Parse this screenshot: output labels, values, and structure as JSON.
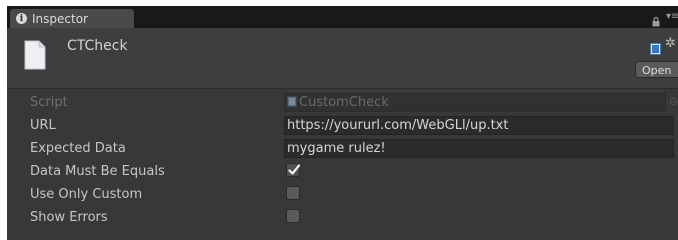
{
  "window": {
    "tab_label": "Inspector",
    "menu_glyph": "▾≡"
  },
  "component": {
    "name": "CTCheck",
    "open_label": "Open",
    "icons": [
      "document-icon",
      "script-icon",
      "gear-icon"
    ]
  },
  "fields": {
    "script": {
      "label": "Script",
      "value": "CustomCheck",
      "picker": "⊙"
    },
    "url": {
      "label": "URL",
      "value": "https://yoururl.com/WebGLl/up.txt"
    },
    "expected_data": {
      "label": "Expected Data",
      "value": "mygame rulez!"
    },
    "data_must_be_equals": {
      "label": "Data Must Be Equals",
      "checked": true
    },
    "use_only_custom": {
      "label": "Use Only Custom",
      "checked": false
    },
    "show_errors": {
      "label": "Show Errors",
      "checked": false
    }
  },
  "colors": {
    "background": "#383838",
    "tabbar": "#191919",
    "text": "#c6c6c6",
    "disabled_text": "#6e6e6e",
    "field_bg": "#2b2b2b"
  }
}
